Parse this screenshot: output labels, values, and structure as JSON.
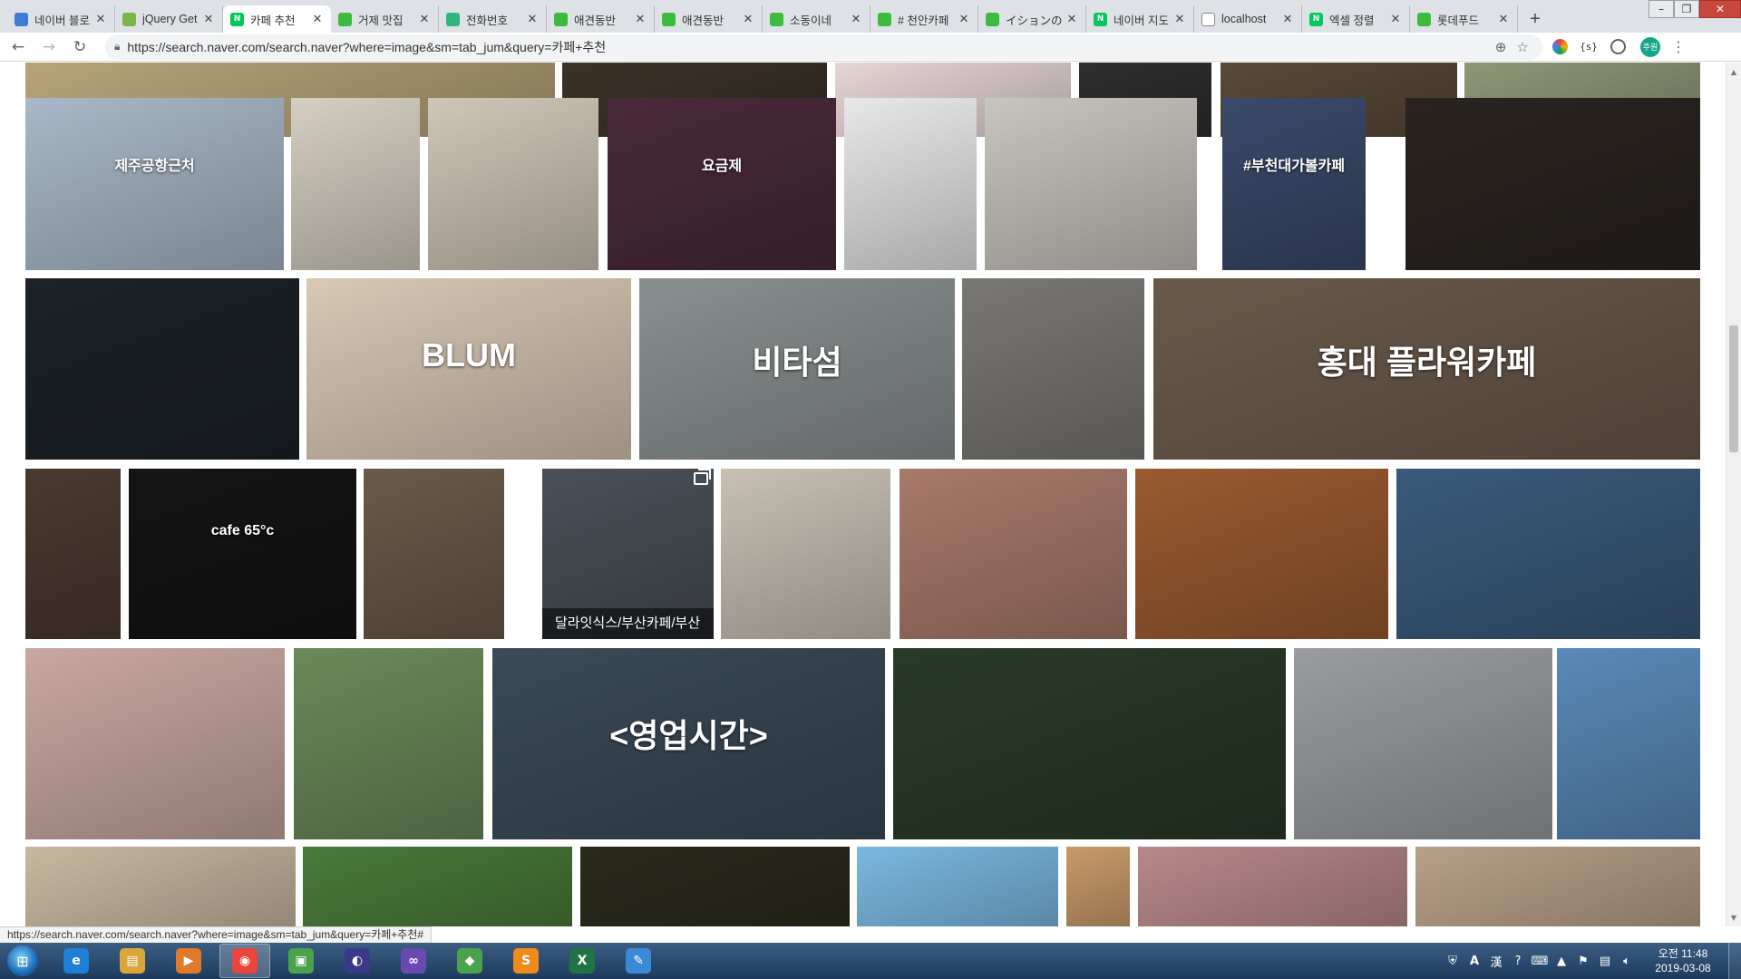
{
  "browser": {
    "tabs": [
      {
        "title": "네이버 블로그",
        "favicon_color": "#3c7bd6",
        "favicon_glyph": ""
      },
      {
        "title": "jQuery Get",
        "favicon_color": "#7ab648",
        "favicon_glyph": ""
      },
      {
        "title": "카페 추천",
        "favicon_color": "#03c75a",
        "favicon_glyph": "N"
      },
      {
        "title": "거제 맛집",
        "favicon_color": "#3dbb3d",
        "favicon_glyph": ""
      },
      {
        "title": "전화번호",
        "favicon_color": "#2eb67d",
        "favicon_glyph": ""
      },
      {
        "title": "애견동반",
        "favicon_color": "#3dbb3d",
        "favicon_glyph": ""
      },
      {
        "title": "애견동반",
        "favicon_color": "#3dbb3d",
        "favicon_glyph": ""
      },
      {
        "title": "소동이네",
        "favicon_color": "#3dbb3d",
        "favicon_glyph": ""
      },
      {
        "title": "# 천안카페",
        "favicon_color": "#3dbb3d",
        "favicon_glyph": ""
      },
      {
        "title": "イションの",
        "favicon_color": "#3dbb3d",
        "favicon_glyph": ""
      },
      {
        "title": "네이버 지도",
        "favicon_color": "#03c75a",
        "favicon_glyph": "N"
      },
      {
        "title": "localhost",
        "favicon_color": "#ffffff",
        "favicon_glyph": ""
      },
      {
        "title": "엑셀 정렬",
        "favicon_color": "#03c75a",
        "favicon_glyph": "N"
      },
      {
        "title": "롯데푸드",
        "favicon_color": "#3dbb3d",
        "favicon_glyph": ""
      }
    ],
    "active_tab_index": 2,
    "new_tab_label": "+",
    "address_url": "https://search.naver.com/search.naver?where=image&sm=tab_jum&query=카페+추천",
    "profile_label": "주원",
    "status_url": "https://search.naver.com/search.naver?where=image&sm=tab_jum&query=카페+추천#"
  },
  "results": {
    "query": "카페 추천",
    "tiles": [
      {
        "alt": "cafe sign",
        "color": "#b8a57a"
      },
      {
        "alt": "interior",
        "color": "#3c3328"
      },
      {
        "alt": "pastel dessert",
        "color": "#e8d8d8"
      },
      {
        "alt": "dark cafe",
        "color": "#2f2f2f"
      },
      {
        "alt": "cafe interior",
        "color": "#5a4a38"
      },
      {
        "alt": "garden",
        "color": "#8f9a78"
      },
      {
        "alt": "blue house cafe",
        "color": "#a8b8c8",
        "overlay": "제주공항근처"
      },
      {
        "alt": "mirror interior",
        "color": "#d5cfc2"
      },
      {
        "alt": "coffee bar",
        "color": "#cfc6b6"
      },
      {
        "alt": "price board",
        "color": "#4a2a3a",
        "overlay": "요금제"
      },
      {
        "alt": "green dessert",
        "color": "#e8e8e8"
      },
      {
        "alt": "gallery cafe",
        "color": "#c8c4be"
      },
      {
        "alt": "night window",
        "color": "#3a4a6a",
        "overlay": "#부천대가볼카페"
      },
      {
        "alt": "night cafe",
        "color": "#2a2420"
      },
      {
        "alt": "corner cafe night",
        "color": "#1c2228"
      },
      {
        "alt": "blum coffee",
        "color": "#d8c8b4",
        "overlay": "BLUM"
      },
      {
        "alt": "lake",
        "color": "#8a9090",
        "overlay": "비타섬"
      },
      {
        "alt": "cafe wall",
        "color": "#7a7874"
      },
      {
        "alt": "flower cafe",
        "color": "#6a5a4a",
        "overlay": "홍대 플라워카페"
      },
      {
        "alt": "brick alley",
        "color": "#4a3a30"
      },
      {
        "alt": "cafe 65",
        "color": "#141414",
        "overlay": "cafe 65°c"
      },
      {
        "alt": "iced drinks",
        "color": "#6a5a48"
      },
      {
        "alt": "cafe building",
        "color": "#4a5058",
        "caption": "달라잇식스/부산카페/부산"
      },
      {
        "alt": "table shot",
        "color": "#c8c0b4"
      },
      {
        "alt": "pink frappe",
        "color": "#a87a6a"
      },
      {
        "alt": "sandwich plate",
        "color": "#9a5a30"
      },
      {
        "alt": "bakehouse",
        "color": "#3a5a7a"
      },
      {
        "alt": "cookie basket",
        "color": "#c8a8a0"
      },
      {
        "alt": "photo collage",
        "color": "#6a8a5a"
      },
      {
        "alt": "evening cafe",
        "color": "#3a4a58",
        "overlay": "<영업시간>"
      },
      {
        "alt": "garden night",
        "color": "#2a3a28"
      },
      {
        "alt": "modern building",
        "color": "#9a9ca0"
      },
      {
        "alt": "sky",
        "color": "#5a8ab8"
      },
      {
        "alt": "board games shelf",
        "color": "#c8b8a0"
      },
      {
        "alt": "garden seating",
        "color": "#4a7a3a"
      },
      {
        "alt": "flower bouquet",
        "color": "#2a2a1c"
      },
      {
        "alt": "blue sky frame",
        "color": "#7ab8e0"
      },
      {
        "alt": "waffle",
        "color": "#c89a6a"
      },
      {
        "alt": "drinks",
        "color": "#b8888a"
      },
      {
        "alt": "coffee beans",
        "color": "#b8a088"
      }
    ]
  },
  "taskbar": {
    "start_label": "⊞",
    "apps": [
      {
        "name": "ie",
        "label": "e",
        "color": "#1e7fd6"
      },
      {
        "name": "explorer",
        "label": "▤",
        "color": "#d9a63a"
      },
      {
        "name": "media",
        "label": "▶",
        "color": "#e07a2a"
      },
      {
        "name": "chrome",
        "label": "◉",
        "color": "#e8453c"
      },
      {
        "name": "remote",
        "label": "▣",
        "color": "#4aa34a"
      },
      {
        "name": "eclipse",
        "label": "◐",
        "color": "#3a3a8a"
      },
      {
        "name": "vs",
        "label": "∞",
        "color": "#6a4ab0"
      },
      {
        "name": "node",
        "label": "◆",
        "color": "#4aa34a"
      },
      {
        "name": "sublime",
        "label": "S",
        "color": "#f08a1a"
      },
      {
        "name": "excel",
        "label": "X",
        "color": "#217346"
      },
      {
        "name": "paint",
        "label": "✎",
        "color": "#3a8ad6"
      }
    ],
    "active_app_index": 3,
    "tray": {
      "ime_a": "A",
      "ime_han": "漢",
      "time": "오전 11:48",
      "date": "2019-03-08"
    }
  }
}
